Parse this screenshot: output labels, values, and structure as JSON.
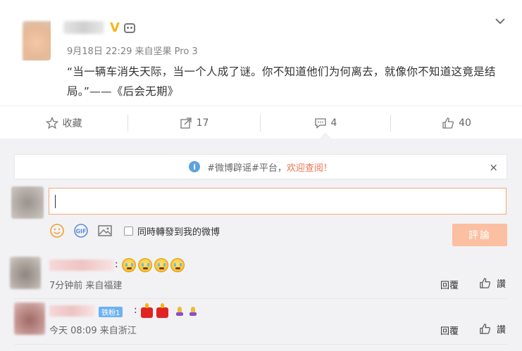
{
  "post": {
    "meta": "9月18日 22:29 来自坚果 Pro 3",
    "text": "“当一辆车消失天际，当一个人成了谜。你不知道他们为何离去，就像你不知道这竟是结局。”——《后会无期》",
    "verified_badge": "V",
    "icons": [
      "robot-icon",
      "chevron-down-icon"
    ]
  },
  "actions": {
    "favorite_label": "收藏",
    "repost_count": "17",
    "comment_count": "4",
    "like_count": "40"
  },
  "notice": {
    "prefix": "#微博辟谣#平台，",
    "highlight": "欢迎查阅！",
    "close": "×"
  },
  "composer": {
    "input_value": "",
    "repost_label": "同時轉發到我的微博",
    "submit_label": "評論",
    "gif_label": "GIF"
  },
  "comments": [
    {
      "colon": ":",
      "emoji_count": 4,
      "meta": "7分钟前 来自福建",
      "reply_label": "回覆",
      "like_label": "讚"
    },
    {
      "badge": "铁粉1",
      "colon": ":",
      "meta": "今天 08:09 来自浙江",
      "reply_label": "回覆",
      "like_label": "讚"
    }
  ],
  "colors": {
    "accent": "#eb7350",
    "input_border": "#f5a77b",
    "submit_bg": "#fbbfa1",
    "badge_bg": "#6eb2f0",
    "comment_bg": "#f2f2f5"
  }
}
